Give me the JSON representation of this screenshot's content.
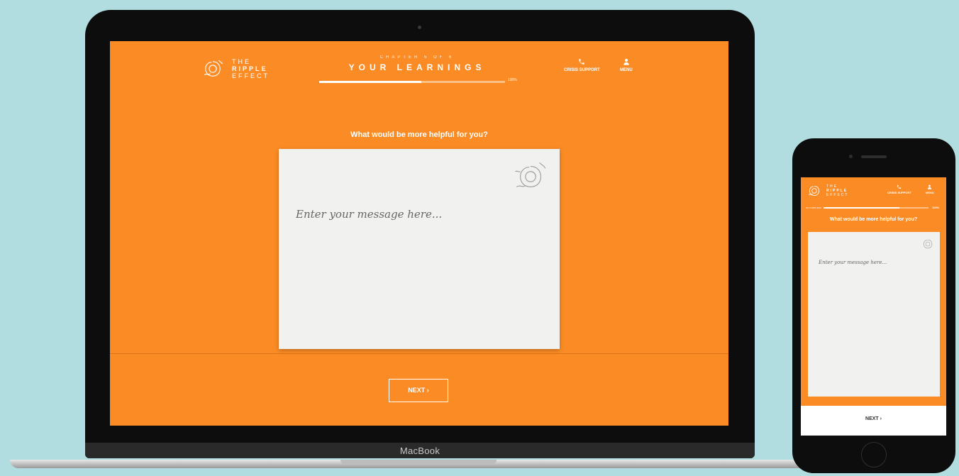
{
  "brand": {
    "line1": "THE",
    "line2": "RIPPLE",
    "line3": "EFFECT"
  },
  "chapter": {
    "kicker": "CHAPTER 5 OF 6",
    "title": "YOUR LEARNINGS",
    "progress": 0.55,
    "progress_label": "100%"
  },
  "nav": {
    "crisis_label": "CRISIS SUPPORT",
    "menu_label": "MENU"
  },
  "question": "What would be more helpful for you?",
  "message": {
    "placeholder": "Enter your message here..."
  },
  "next_label": "NEXT ›",
  "device_label": "MacBook",
  "mobile": {
    "pct_left": "0% COMPLETE",
    "pct_right": "100%",
    "progress": 0.72,
    "next_label": "NEXT ›"
  },
  "colors": {
    "background": "#b2dde0",
    "brand_orange": "#fb8c25",
    "card": "#f1f1f0"
  }
}
